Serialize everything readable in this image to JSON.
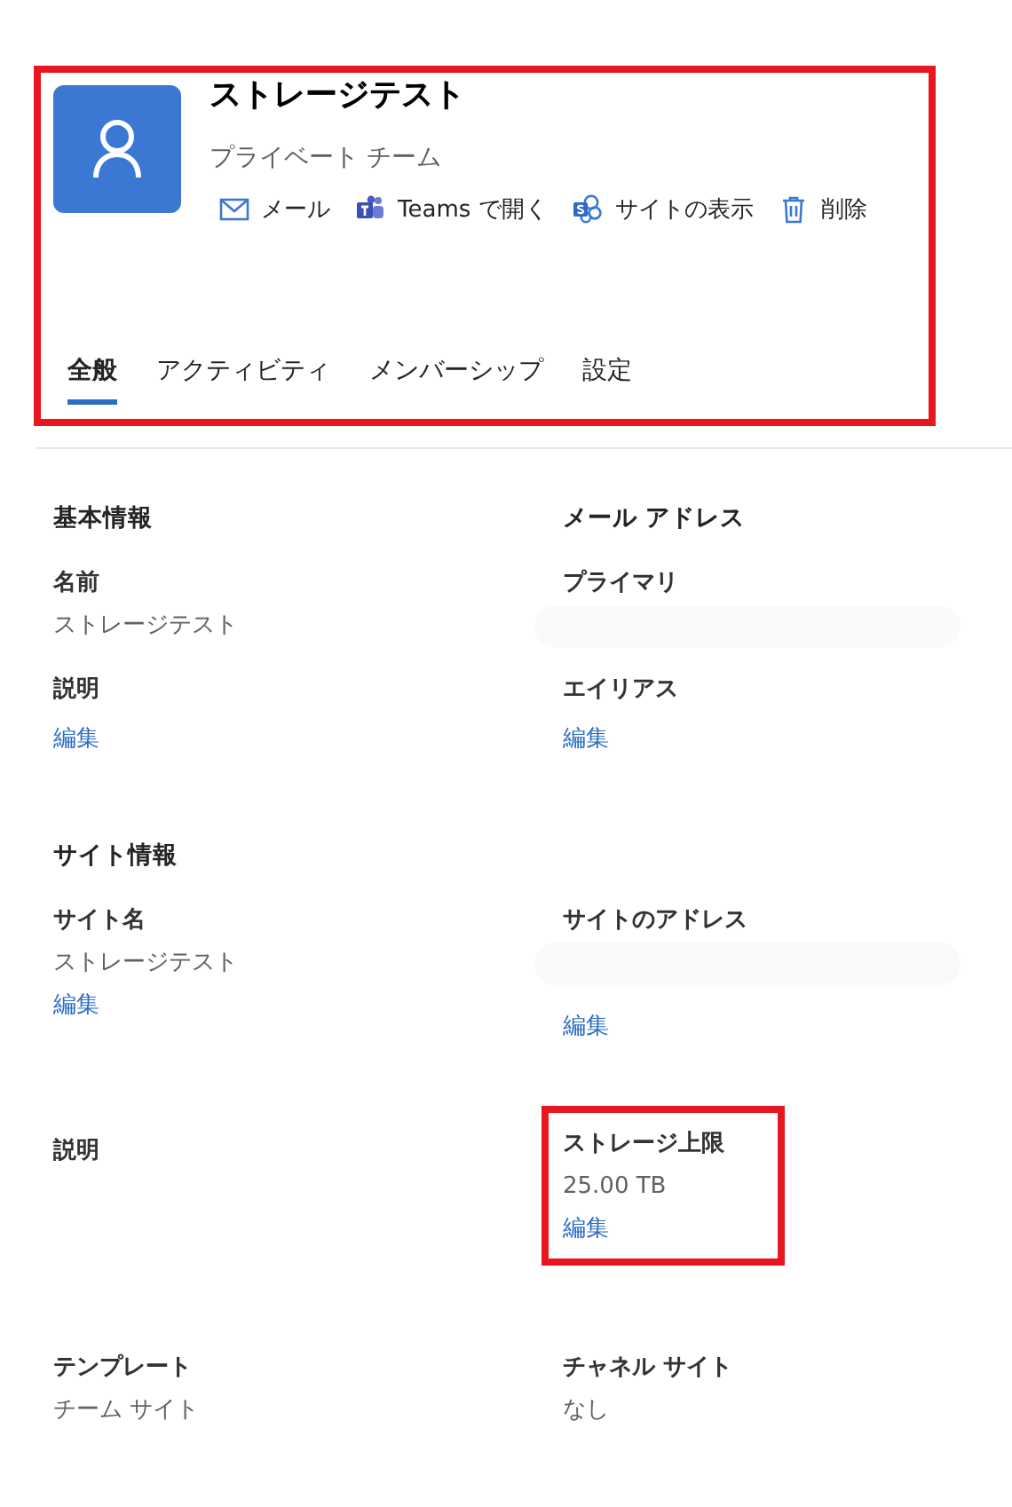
{
  "header": {
    "highlighted": true,
    "title": "ストレージテスト",
    "subtitle": "プライベート チーム",
    "actions": [
      {
        "kind": "mail",
        "label": "メール"
      },
      {
        "kind": "teams",
        "label": "Teams で開く"
      },
      {
        "kind": "site",
        "label": "サイトの表示"
      },
      {
        "kind": "delete",
        "label": "削除"
      }
    ],
    "tabs": [
      {
        "label": "全般",
        "selected": true
      },
      {
        "label": "アクティビティ",
        "selected": false
      },
      {
        "label": "メンバーシップ",
        "selected": false
      },
      {
        "label": "設定",
        "selected": false
      }
    ]
  },
  "rows": [
    {
      "kind": "heading",
      "cells": [
        {
          "highlighted": false,
          "items": [
            {
              "kind": "heading",
              "text": "基本情報"
            }
          ]
        },
        {
          "highlighted": false,
          "items": [
            {
              "kind": "heading",
              "text": "メール アドレス"
            }
          ]
        }
      ]
    },
    {
      "kind": "fields",
      "cells": [
        {
          "highlighted": false,
          "items": [
            {
              "kind": "label",
              "text": "名前"
            },
            {
              "kind": "value",
              "text": "ストレージテスト"
            },
            {
              "kind": "label",
              "text": "説明"
            },
            {
              "kind": "link",
              "text": "編集"
            }
          ]
        },
        {
          "highlighted": false,
          "items": [
            {
              "kind": "label",
              "text": "プライマリ"
            },
            {
              "kind": "redacted"
            },
            {
              "kind": "label",
              "text": "エイリアス"
            },
            {
              "kind": "link",
              "text": "編集"
            }
          ]
        }
      ]
    },
    {
      "kind": "heading",
      "cells": [
        {
          "highlighted": false,
          "items": [
            {
              "kind": "heading",
              "text": "サイト情報"
            }
          ]
        }
      ]
    },
    {
      "kind": "fields",
      "cells": [
        {
          "highlighted": false,
          "items": [
            {
              "kind": "label",
              "text": "サイト名"
            },
            {
              "kind": "value",
              "text": "ストレージテスト"
            },
            {
              "kind": "link",
              "text": "編集"
            }
          ]
        },
        {
          "highlighted": false,
          "items": [
            {
              "kind": "label",
              "text": "サイトのアドレス"
            },
            {
              "kind": "redacted"
            },
            {
              "kind": "link",
              "text": "編集"
            }
          ]
        }
      ]
    },
    {
      "kind": "fields",
      "cells": [
        {
          "highlighted": false,
          "items": [
            {
              "kind": "label",
              "text": "説明"
            }
          ]
        },
        {
          "highlighted": true,
          "items": [
            {
              "kind": "label",
              "text": "ストレージ上限"
            },
            {
              "kind": "value",
              "text": "25.00 TB"
            },
            {
              "kind": "link",
              "text": "編集"
            }
          ]
        }
      ]
    },
    {
      "kind": "fields",
      "cells": [
        {
          "highlighted": false,
          "items": [
            {
              "kind": "label",
              "text": "テンプレート"
            },
            {
              "kind": "value",
              "text": "チーム サイト"
            }
          ]
        },
        {
          "highlighted": false,
          "items": [
            {
              "kind": "label",
              "text": "チャネル サイト"
            },
            {
              "kind": "value",
              "text": "なし"
            }
          ]
        }
      ]
    }
  ]
}
